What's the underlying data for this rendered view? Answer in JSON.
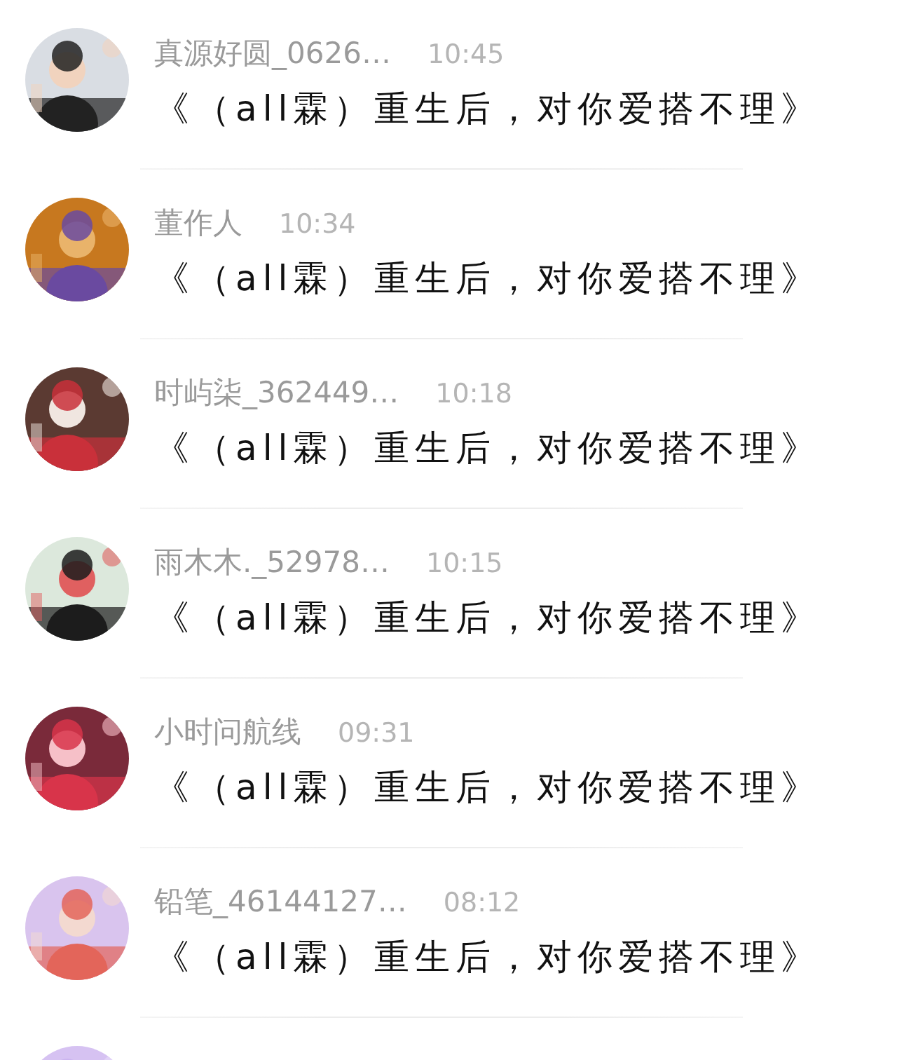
{
  "messages": [
    {
      "avatar": {
        "kind": "picture"
      },
      "name": "真源好圆_0626…",
      "time": "10:45",
      "text": "《（all霖）重生后，对你爱搭不理》"
    },
    {
      "avatar": {
        "kind": "picture"
      },
      "name": "董作人",
      "time": "10:34",
      "text": "《（all霖）重生后，对你爱搭不理》"
    },
    {
      "avatar": {
        "kind": "picture"
      },
      "name": "时屿柒_362449…",
      "time": "10:18",
      "text": "《（all霖）重生后，对你爱搭不理》"
    },
    {
      "avatar": {
        "kind": "picture"
      },
      "name": "雨木木._52978…",
      "time": "10:15",
      "text": "《（all霖）重生后，对你爱搭不理》"
    },
    {
      "avatar": {
        "kind": "picture"
      },
      "name": "小时问航线",
      "time": "09:31",
      "text": "《（all霖）重生后，对你爱搭不理》"
    },
    {
      "avatar": {
        "kind": "picture"
      },
      "name": "铅笔_46144127…",
      "time": "08:12",
      "text": "《（all霖）重生后，对你爱搭不理》"
    },
    {
      "avatar": {
        "kind": "picture"
      }
    }
  ]
}
